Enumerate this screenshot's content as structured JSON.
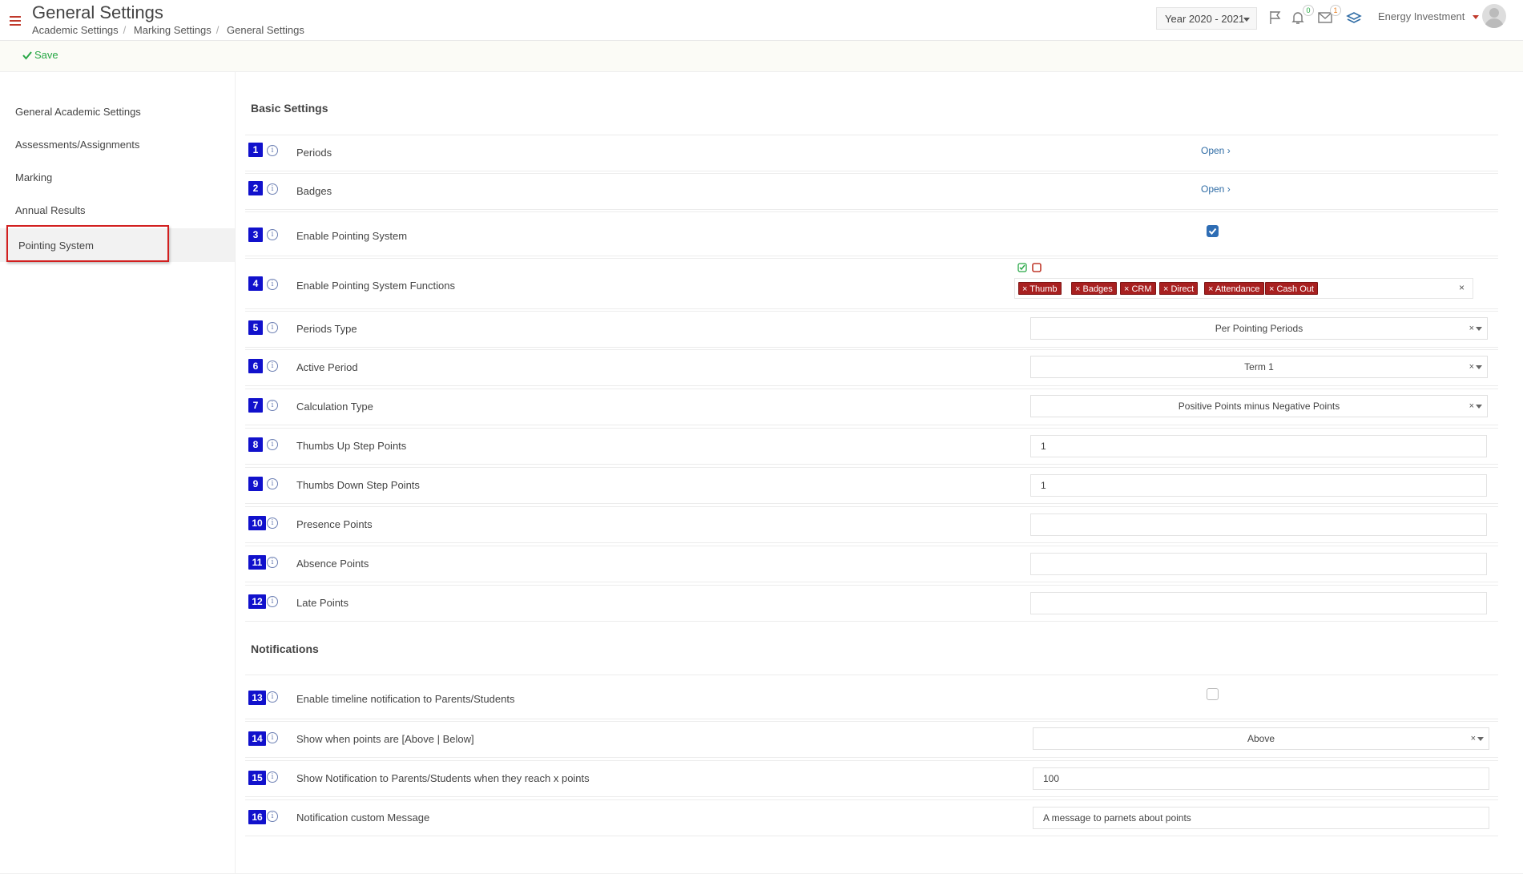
{
  "header": {
    "title": "General Settings",
    "breadcrumb": [
      "Academic Settings",
      "Marking Settings",
      "General Settings"
    ],
    "year": "Year 2020 - 2021",
    "notif_count": "0",
    "mail_count": "1",
    "user_name": "Energy Investment",
    "accent_color": "#c0392b"
  },
  "toolbar": {
    "save_label": "Save"
  },
  "sidebar": {
    "items": [
      {
        "label": "General Academic Settings"
      },
      {
        "label": "Assessments/Assignments"
      },
      {
        "label": "Marking"
      },
      {
        "label": "Annual Results"
      },
      {
        "label": "Pointing System"
      }
    ],
    "active": "Pointing System"
  },
  "sections": {
    "basic": "Basic Settings",
    "notifications": "Notifications"
  },
  "settings": [
    {
      "num": "1",
      "label": "Periods",
      "link": "Open"
    },
    {
      "num": "2",
      "label": "Badges",
      "link": "Open"
    },
    {
      "num": "3",
      "label": "Enable Pointing System",
      "checked": true
    },
    {
      "num": "4",
      "label": "Enable Pointing System Functions",
      "tags": [
        "Thumb",
        "Badges",
        "CRM",
        "Direct",
        "Attendance",
        "Cash Out"
      ]
    },
    {
      "num": "5",
      "label": "Periods Type",
      "value": "Per Pointing Periods"
    },
    {
      "num": "6",
      "label": "Active Period",
      "value": "Term 1"
    },
    {
      "num": "7",
      "label": "Calculation Type",
      "value": "Positive Points minus Negative Points"
    },
    {
      "num": "8",
      "label": "Thumbs Up Step Points",
      "value": "1"
    },
    {
      "num": "9",
      "label": "Thumbs Down Step Points",
      "value": "1"
    },
    {
      "num": "10",
      "label": "Presence Points",
      "value": ""
    },
    {
      "num": "11",
      "label": "Absence Points",
      "value": ""
    },
    {
      "num": "12",
      "label": "Late Points",
      "value": ""
    },
    {
      "num": "13",
      "label": "Enable timeline notification to Parents/Students",
      "checked": false
    },
    {
      "num": "14",
      "label": "Show when points are [Above | Below]",
      "value": "Above"
    },
    {
      "num": "15",
      "label": "Show Notification to Parents/Students when they reach x points",
      "value": "100"
    },
    {
      "num": "16",
      "label": "Notification custom Message",
      "value": "A message to parnets about points"
    }
  ],
  "colors": {
    "number_badge": "#1111cc",
    "tag": "#a82020",
    "link": "#2f6ca5",
    "save": "#27a745"
  }
}
